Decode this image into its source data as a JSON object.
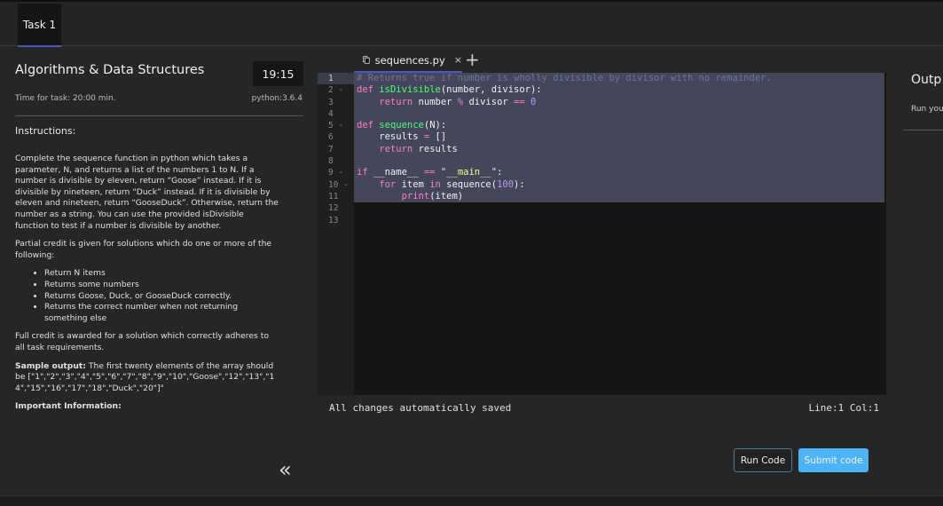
{
  "top_tabs": [
    {
      "label": "Task 1"
    }
  ],
  "task": {
    "title": "Algorithms & Data Structures",
    "timer": "19:15",
    "time_for_task": "Time for task: 20:00 min.",
    "language": "python:3.6.4",
    "instructions_heading": "Instructions:",
    "paragraph1": "Complete the sequence function in python which takes a parameter, N, and returns a list of the numbers 1 to N. If a number is divisible by eleven, return “Goose” instead. If it is divisible by nineteen, return “Duck” instead. If it is divisible by eleven and nineteen, return “GooseDuck”. Otherwise, return the number as a string. You can use the provided isDivisible function to test if a number is divisible by another.",
    "paragraph2": "Partial credit is given for solutions which do one or more of the following:",
    "bullets": [
      "Return N items",
      "Returns some numbers",
      "Returns Goose, Duck, or GooseDuck correctly.",
      "Returns the correct number when not returning something else"
    ],
    "paragraph3": "Full credit is awarded for a solution which correctly adheres to all task requirements.",
    "sample_label": "Sample output:",
    "sample_text": " The first twenty elements of the array should be [\"1\",\"2\",\"3\",\"4\",\"5\",\"6\",\"7\",\"8\",\"9\",\"10\",\"Goose\",\"12\",\"13\",\"14\",\"15\",\"16\",\"17\",\"18\",\"Duck\",\"20\"]\"",
    "important_label": "Important Information:",
    "collapse_icon": "«"
  },
  "editor": {
    "file_tab": "sequences.py",
    "close_icon": "×",
    "add_icon": "+",
    "line_numbers": [
      "1",
      "2",
      "3",
      "4",
      "5",
      "6",
      "7",
      "8",
      "9",
      "10",
      "11",
      "12",
      "13"
    ],
    "code": [
      [
        [
          "# Returns true if number is wholly divisible by divisor with no remainder.",
          "comment"
        ]
      ],
      [
        [
          "def ",
          "kw"
        ],
        [
          "isDivisible",
          "fn"
        ],
        [
          "(number, divisor):",
          "plain"
        ]
      ],
      [
        [
          "    return ",
          "kw"
        ],
        [
          "number ",
          "plain"
        ],
        [
          "% ",
          "op"
        ],
        [
          "divisor ",
          "plain"
        ],
        [
          "== ",
          "op"
        ],
        [
          "0",
          "num"
        ]
      ],
      [],
      [
        [
          "def ",
          "kw"
        ],
        [
          "sequence",
          "fn"
        ],
        [
          "(N):",
          "plain"
        ]
      ],
      [
        [
          "    results ",
          "plain"
        ],
        [
          "= ",
          "op"
        ],
        [
          "[]",
          "plain"
        ]
      ],
      [
        [
          "    return ",
          "kw"
        ],
        [
          "results",
          "plain"
        ]
      ],
      [],
      [
        [
          "if ",
          "kw"
        ],
        [
          "__name__ ",
          "plain"
        ],
        [
          "== ",
          "op"
        ],
        [
          "\"",
          "plain"
        ],
        [
          "__main__",
          "str"
        ],
        [
          "\":",
          "plain"
        ]
      ],
      [
        [
          "    for ",
          "kw"
        ],
        [
          "item ",
          "plain"
        ],
        [
          "in ",
          "kw"
        ],
        [
          "sequence(",
          "plain"
        ],
        [
          "100",
          "num"
        ],
        [
          "):",
          "plain"
        ]
      ],
      [
        [
          "        print",
          "kw"
        ],
        [
          "(item)",
          "plain"
        ]
      ],
      [],
      []
    ],
    "selected_lines": 11,
    "status_saved": "All changes automatically saved",
    "cursor": "Line:1 Col:1"
  },
  "buttons": {
    "run": "Run Code",
    "submit": "Submit code"
  },
  "output": {
    "heading": "Outp",
    "hint": "Run you"
  }
}
